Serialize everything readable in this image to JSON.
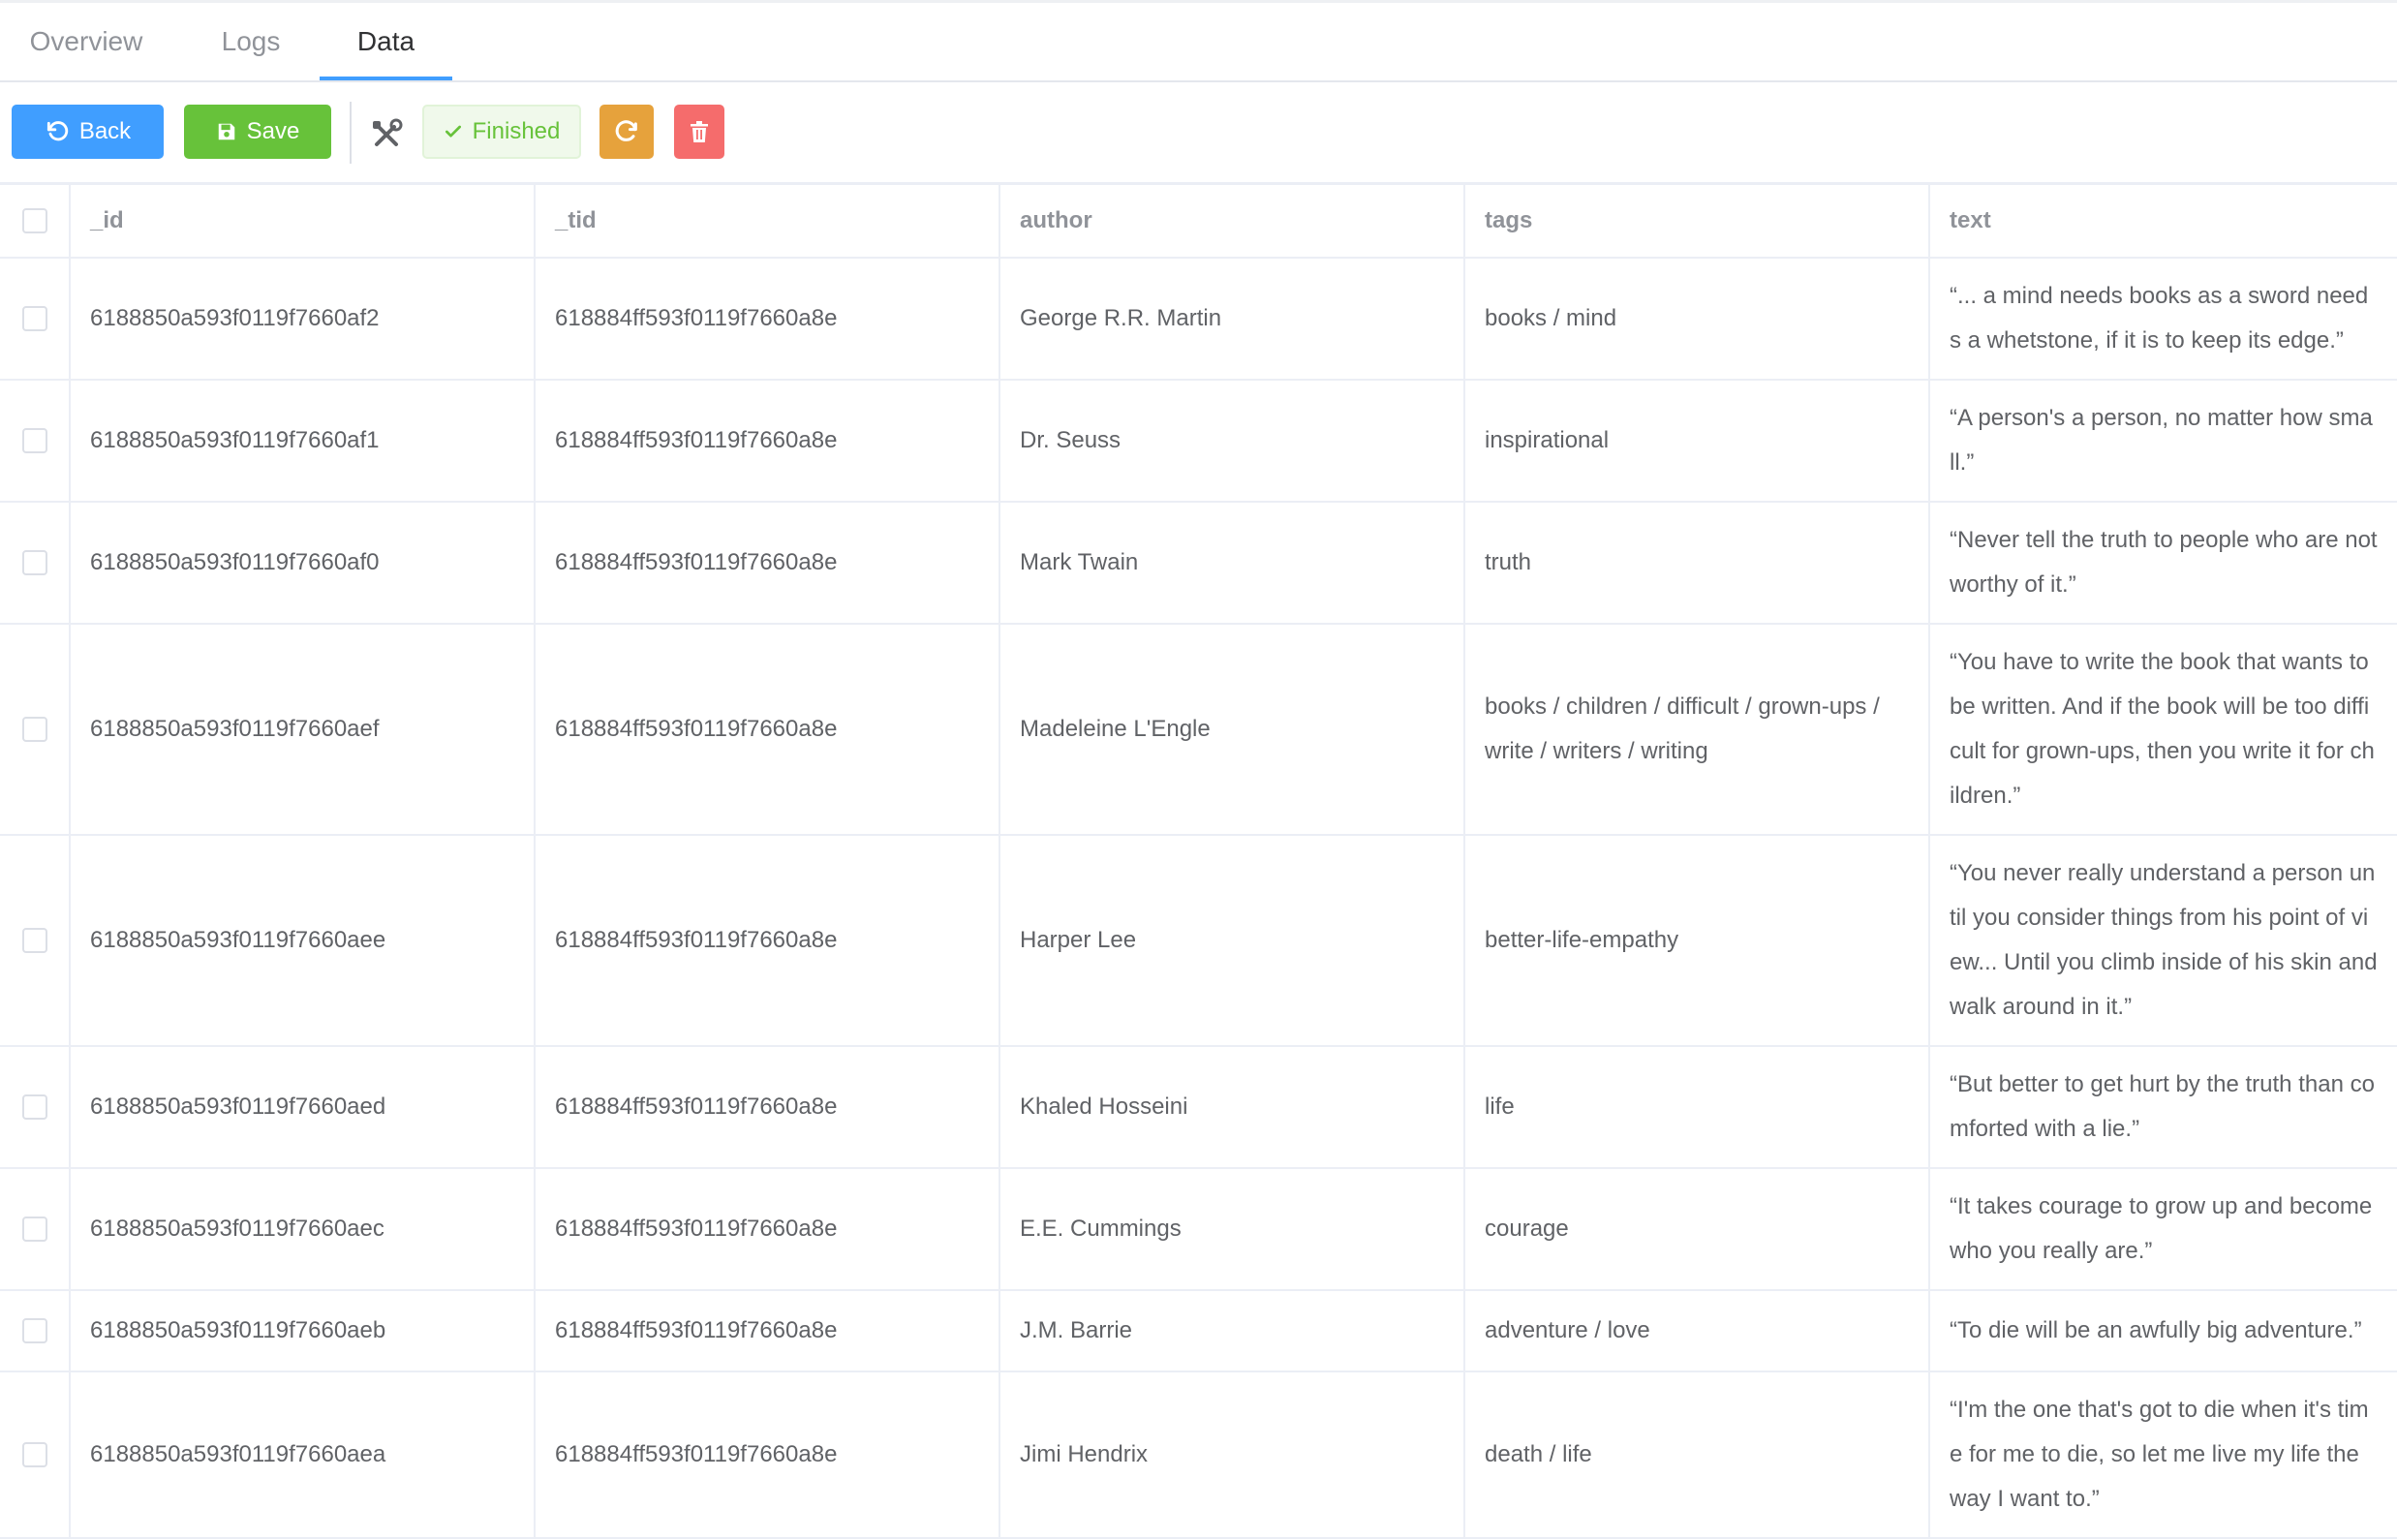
{
  "tabs": [
    {
      "label": "Overview"
    },
    {
      "label": "Logs"
    },
    {
      "label": "Data"
    }
  ],
  "active_tab": "Data",
  "toolbar": {
    "back_label": "Back",
    "save_label": "Save",
    "finished_label": "Finished",
    "tools_icon": "tools-icon",
    "refresh_icon": "refresh-icon",
    "delete_icon": "trash-icon"
  },
  "colors": {
    "primary": "#409eff",
    "success": "#67c23a",
    "warning": "#e6a23c",
    "danger": "#f56c6c"
  },
  "table": {
    "columns": [
      "_id",
      "_tid",
      "author",
      "tags",
      "text"
    ],
    "rows": [
      {
        "_id": "6188850a593f0119f7660af2",
        "_tid": "618884ff593f0119f7660a8e",
        "author": "George R.R. Martin",
        "tags": "books / mind",
        "text": "“... a mind needs books as a sword needs a whetstone, if it is to keep its edge.”"
      },
      {
        "_id": "6188850a593f0119f7660af1",
        "_tid": "618884ff593f0119f7660a8e",
        "author": "Dr. Seuss",
        "tags": "inspirational",
        "text": "“A person's a person, no matter how small.”"
      },
      {
        "_id": "6188850a593f0119f7660af0",
        "_tid": "618884ff593f0119f7660a8e",
        "author": "Mark Twain",
        "tags": "truth",
        "text": "“Never tell the truth to people who are not worthy of it.”"
      },
      {
        "_id": "6188850a593f0119f7660aef",
        "_tid": "618884ff593f0119f7660a8e",
        "author": "Madeleine L'Engle",
        "tags": "books / children / difficult / grown-ups / write / writers / writing",
        "text": "“You have to write the book that wants to be written. And if the book will be too difficult for grown-ups, then you write it for children.”"
      },
      {
        "_id": "6188850a593f0119f7660aee",
        "_tid": "618884ff593f0119f7660a8e",
        "author": "Harper Lee",
        "tags": "better-life-empathy",
        "text": "“You never really understand a person until you consider things from his point of view... Until you climb inside of his skin and walk around in it.”"
      },
      {
        "_id": "6188850a593f0119f7660aed",
        "_tid": "618884ff593f0119f7660a8e",
        "author": "Khaled Hosseini",
        "tags": "life",
        "text": "“But better to get hurt by the truth than comforted with a lie.”"
      },
      {
        "_id": "6188850a593f0119f7660aec",
        "_tid": "618884ff593f0119f7660a8e",
        "author": "E.E. Cummings",
        "tags": "courage",
        "text": "“It takes courage to grow up and become who you really are.”"
      },
      {
        "_id": "6188850a593f0119f7660aeb",
        "_tid": "618884ff593f0119f7660a8e",
        "author": "J.M. Barrie",
        "tags": "adventure / love",
        "text": "“To die will be an awfully big adventure.”"
      },
      {
        "_id": "6188850a593f0119f7660aea",
        "_tid": "618884ff593f0119f7660a8e",
        "author": "Jimi Hendrix",
        "tags": "death / life",
        "text": "“I'm the one that's got to die when it's time for me to die, so let me live my life the way I want to.”"
      }
    ]
  }
}
